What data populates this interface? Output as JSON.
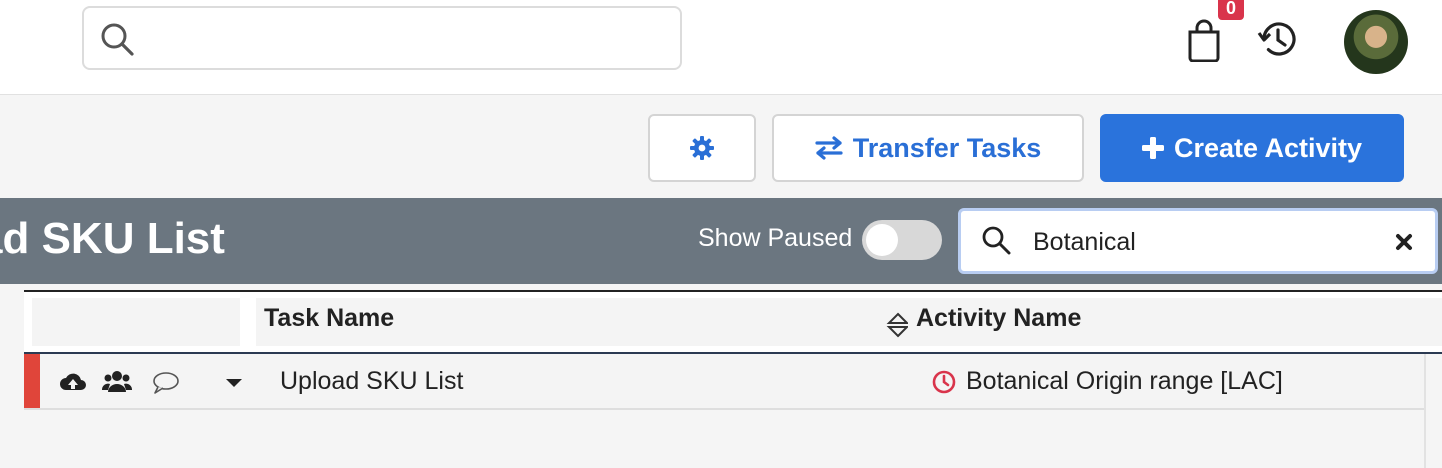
{
  "top_search": {
    "value": "",
    "placeholder": ""
  },
  "cart": {
    "count": "0"
  },
  "toolbar": {
    "transfer_label": "Transfer Tasks",
    "create_label": "Create Activity"
  },
  "band": {
    "title": "ad SKU List",
    "show_paused_label": "Show Paused",
    "show_paused_on": false,
    "search_value": "Botanical"
  },
  "table": {
    "columns": [
      "",
      "Task Name",
      "Activity Name"
    ],
    "rows": [
      {
        "task": "Upload SKU List",
        "activity": "Botanical Origin range [LAC]",
        "priority_color": "#e0453a"
      }
    ]
  },
  "colors": {
    "accent": "#2a73dc",
    "badge": "#d9344b",
    "band": "#6b7680",
    "overdue": "#d9344b"
  },
  "icons": [
    "search-icon",
    "shopping-bag-icon",
    "history-icon",
    "gear-icon",
    "transfer-arrows-icon",
    "plus-icon",
    "close-icon",
    "cloud-upload-icon",
    "users-icon",
    "comment-icon",
    "caret-down-icon",
    "clock-icon",
    "sort-icon"
  ]
}
